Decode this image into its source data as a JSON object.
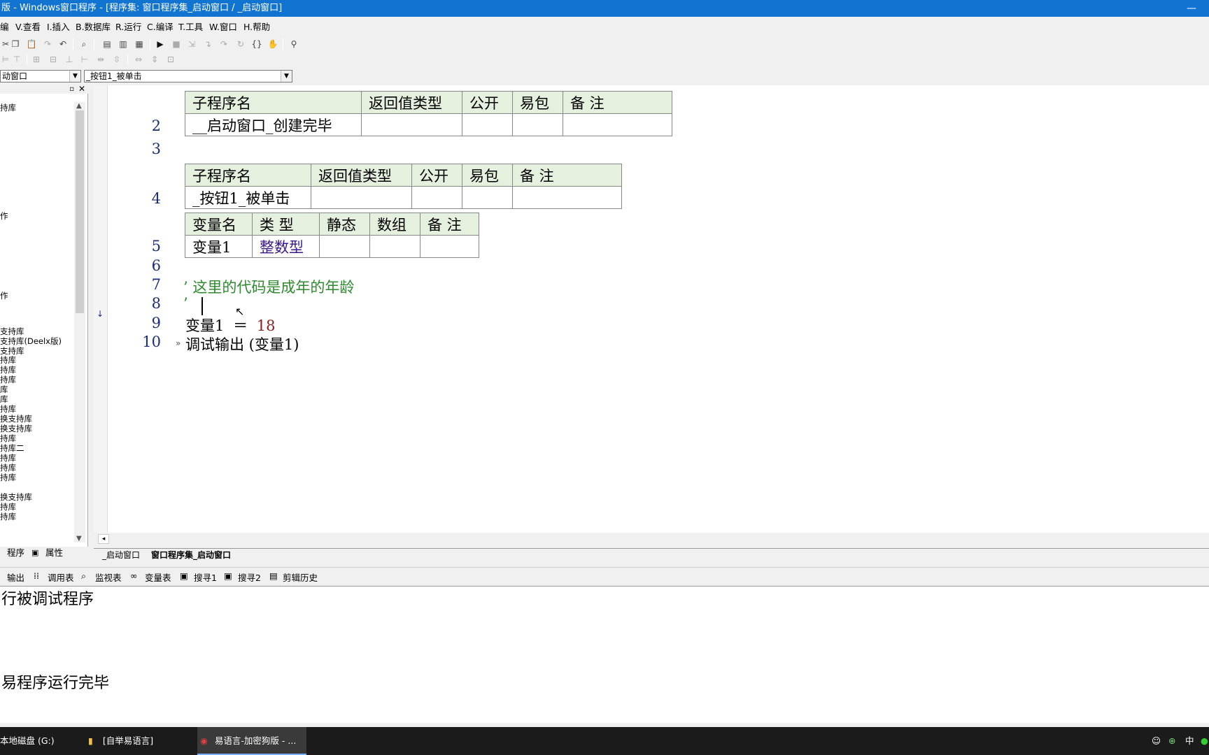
{
  "window": {
    "title": "版 - Windows窗口程序 - [程序集: 窗口程序集_启动窗口 / _启动窗口]"
  },
  "menu": {
    "items": [
      "编",
      "V.查看",
      "I.插入",
      "B.数据库",
      "R.运行",
      "C.编译",
      "T.工具",
      "W.窗口",
      "H.帮助"
    ]
  },
  "combos": {
    "object": "动窗口",
    "method": "_按钮1_被单击"
  },
  "left_tree": {
    "items": [
      "持库",
      "作",
      "作",
      "支持库",
      "支持库(Deelx版)",
      "支持库",
      "持库",
      "持库",
      "持库",
      "库",
      "库",
      "持库",
      "换支持库",
      "换支持库",
      "持库",
      "持库二",
      "持库",
      "持库",
      "持库",
      "换支持库",
      "持库",
      "持库"
    ]
  },
  "left_tabs": {
    "program": "程序",
    "props": "属性"
  },
  "editor": {
    "table1": {
      "headers": [
        "子程序名",
        "返回值类型",
        "公开",
        "易包",
        "备 注"
      ],
      "row": [
        "__启动窗口_创建完毕",
        "",
        "",
        "",
        ""
      ],
      "line": "2"
    },
    "line3": "3",
    "table2": {
      "headers": [
        "子程序名",
        "返回值类型",
        "公开",
        "易包",
        "备 注"
      ],
      "row": [
        "_按钮1_被单击",
        "",
        "",
        "",
        ""
      ],
      "line": "4"
    },
    "table3": {
      "headers": [
        "变量名",
        "类 型",
        "静态",
        "数组",
        "备 注"
      ],
      "row": [
        "变量1",
        "整数型",
        "",
        "",
        ""
      ],
      "line": "5"
    },
    "line6": "6",
    "line7": {
      "num": "7",
      "text": "’ 这里的代码是成年的年龄"
    },
    "line8": {
      "num": "8",
      "text": "’"
    },
    "line9": {
      "num": "9",
      "var": "变量1",
      "op": "＝",
      "val": "18"
    },
    "line10": {
      "num": "10",
      "text": "调试输出 (变量1)"
    }
  },
  "editor_tabs": [
    "_启动窗口",
    "窗口程序集_启动窗口"
  ],
  "bottom_tabs": [
    "输出",
    "调用表",
    "监视表",
    "变量表",
    "搜寻1",
    "搜寻2",
    "剪辑历史"
  ],
  "output": {
    "lines": [
      "行被调试程序",
      "易程序运行完毕"
    ]
  },
  "taskbar": {
    "tasks": [
      "本地磁盘 (G:)",
      "[自举易语言]",
      "易语言-加密狗版 - ..."
    ],
    "ime": "中"
  },
  "colors": {
    "titlebar": "#1174d0",
    "header_cell": "#e6f0de",
    "comment": "#2d8a2d",
    "type_keyword": "#3a1a8a"
  }
}
